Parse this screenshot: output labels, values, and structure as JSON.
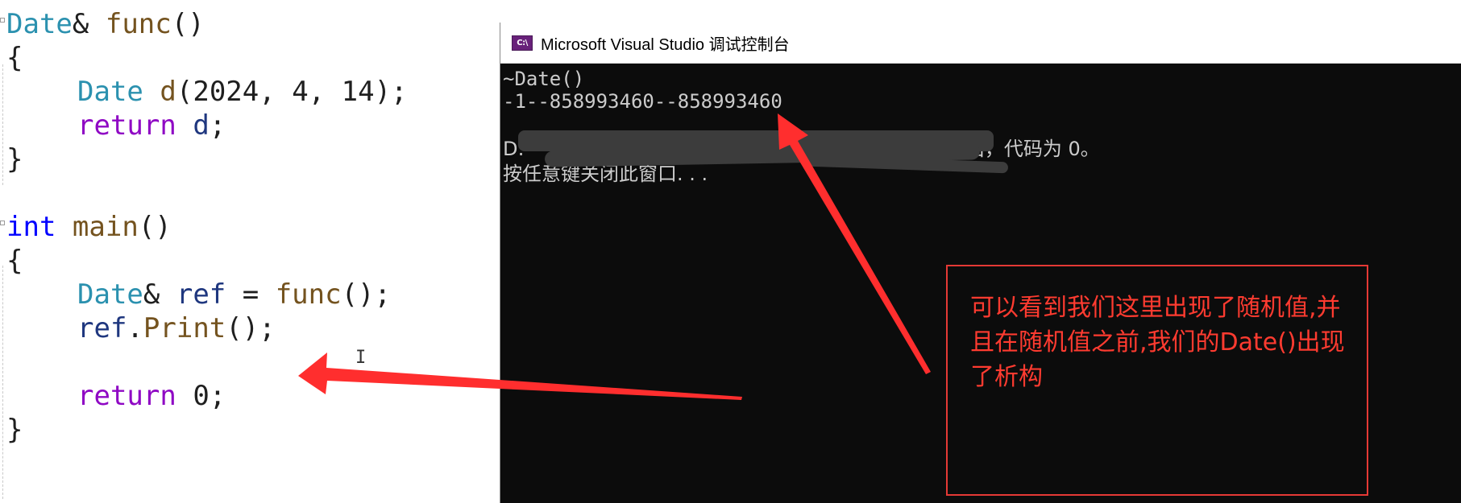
{
  "editor": {
    "lines": [
      [
        {
          "t": "Date",
          "c": "type"
        },
        {
          "t": "& ",
          "c": "punc"
        },
        {
          "t": "func",
          "c": "fn"
        },
        {
          "t": "()",
          "c": "punc"
        }
      ],
      [
        {
          "t": "{",
          "c": "punc"
        }
      ],
      [
        {
          "t": "Date",
          "c": "type"
        },
        {
          "t": " ",
          "c": "punc"
        },
        {
          "t": "d",
          "c": "fn"
        },
        {
          "t": "(",
          "c": "punc"
        },
        {
          "t": "2024",
          "c": "punc"
        },
        {
          "t": ", ",
          "c": "punc"
        },
        {
          "t": "4",
          "c": "punc"
        },
        {
          "t": ", ",
          "c": "punc"
        },
        {
          "t": "14",
          "c": "punc"
        },
        {
          "t": ");",
          "c": "punc"
        }
      ],
      [
        {
          "t": "return",
          "c": "kw2"
        },
        {
          "t": " ",
          "c": "punc"
        },
        {
          "t": "d",
          "c": "var"
        },
        {
          "t": ";",
          "c": "punc"
        }
      ],
      [
        {
          "t": "}",
          "c": "punc"
        }
      ],
      [],
      [
        {
          "t": "int",
          "c": "kw"
        },
        {
          "t": " ",
          "c": "punc"
        },
        {
          "t": "main",
          "c": "fn"
        },
        {
          "t": "()",
          "c": "punc"
        }
      ],
      [
        {
          "t": "{",
          "c": "punc"
        }
      ],
      [
        {
          "t": "Date",
          "c": "type"
        },
        {
          "t": "& ",
          "c": "punc"
        },
        {
          "t": "ref",
          "c": "var"
        },
        {
          "t": " = ",
          "c": "punc"
        },
        {
          "t": "func",
          "c": "fn"
        },
        {
          "t": "();",
          "c": "punc"
        }
      ],
      [
        {
          "t": "ref",
          "c": "var"
        },
        {
          "t": ".",
          "c": "punc"
        },
        {
          "t": "Print",
          "c": "fn"
        },
        {
          "t": "();",
          "c": "punc"
        }
      ],
      [],
      [
        {
          "t": "return",
          "c": "kw2"
        },
        {
          "t": " ",
          "c": "punc"
        },
        {
          "t": "0",
          "c": "punc"
        },
        {
          "t": ";",
          "c": "punc"
        }
      ],
      [
        {
          "t": "}",
          "c": "punc"
        }
      ]
    ],
    "indented": [
      false,
      false,
      true,
      true,
      false,
      false,
      false,
      false,
      true,
      true,
      false,
      true,
      false
    ]
  },
  "console_window": {
    "title": "Microsoft Visual Studio 调试控制台",
    "icon": "visual-studio-icon",
    "icon_text": "C:\\",
    "output_lines": [
      "~Date()",
      "-1--858993460--858993460",
      "",
      "D:                                         xe (进程 31224)已退出，代码为 0。",
      "按任意键关闭此窗口. . ."
    ]
  },
  "annotation": {
    "text": "可以看到我们这里出现了随机值,并且在随机值之前,我们的Date()出现了析构"
  },
  "colors": {
    "type": "#2b91af",
    "keyword": "#0000ff",
    "control_keyword": "#8f08c4",
    "function": "#74531f",
    "variable": "#1f377f",
    "console_bg": "#0c0c0c",
    "console_text": "#cccccc",
    "annotation_red": "#ff3b30"
  }
}
